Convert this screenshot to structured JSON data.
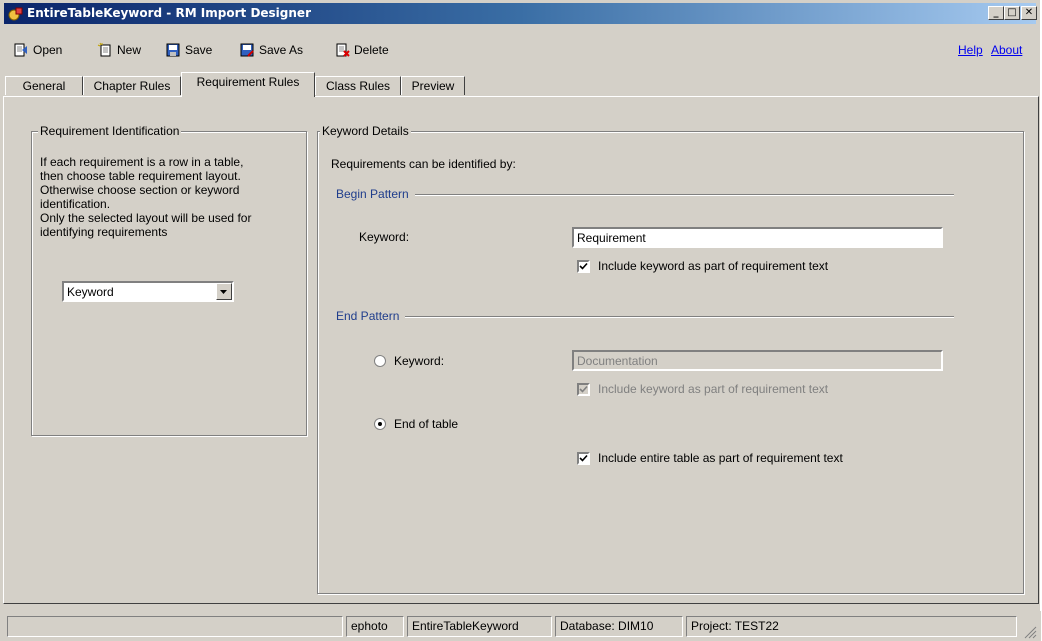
{
  "window": {
    "title": "EntireTableKeyword - RM Import Designer",
    "minimize": "_",
    "maximize": "□",
    "close": "✕"
  },
  "toolbar": {
    "open_label": "Open",
    "new_label": "New",
    "save_label": "Save",
    "save_as_label": "Save As",
    "delete_label": "Delete",
    "help_label": "Help",
    "about_label": "About"
  },
  "tabs": [
    "General",
    "Chapter Rules",
    "Requirement Rules",
    "Class Rules",
    "Preview"
  ],
  "active_tab": "Requirement Rules",
  "requirement_identification": {
    "legend": "Requirement Identification",
    "description_lines": [
      "If each requirement is a row in a table,",
      "then choose table requirement layout.",
      "Otherwise choose section or keyword",
      "identification.",
      "Only the selected layout will be used for",
      "identifying requirements"
    ],
    "layout_selected": "Keyword"
  },
  "keyword_details": {
    "legend": "Keyword Details",
    "intro": "Requirements can be identified by:",
    "begin_pattern": {
      "label": "Begin Pattern",
      "keyword_label": "Keyword:",
      "keyword_value": "Requirement",
      "include_label": "Include keyword as part of requirement text",
      "include_checked": true
    },
    "end_pattern": {
      "label": "End Pattern",
      "keyword_option_label": "Keyword:",
      "keyword_value": "Documentation",
      "include_keyword_label": "Include keyword as part of requirement text",
      "include_keyword_checked": true,
      "end_of_table_label": "End of table",
      "selected_option": "End of table",
      "include_table_label": "Include entire table as part of requirement text",
      "include_table_checked": true
    }
  },
  "statusbar": {
    "user": "ephoto",
    "design": "EntireTableKeyword",
    "database": "Database: DIM10",
    "project": "Project: TEST22"
  },
  "icons": [
    "app-icon",
    "open-icon",
    "new-icon",
    "save-icon",
    "save-as-icon",
    "delete-icon",
    "dropdown-arrow-icon",
    "checkmark-icon",
    "resize-grip-icon"
  ]
}
